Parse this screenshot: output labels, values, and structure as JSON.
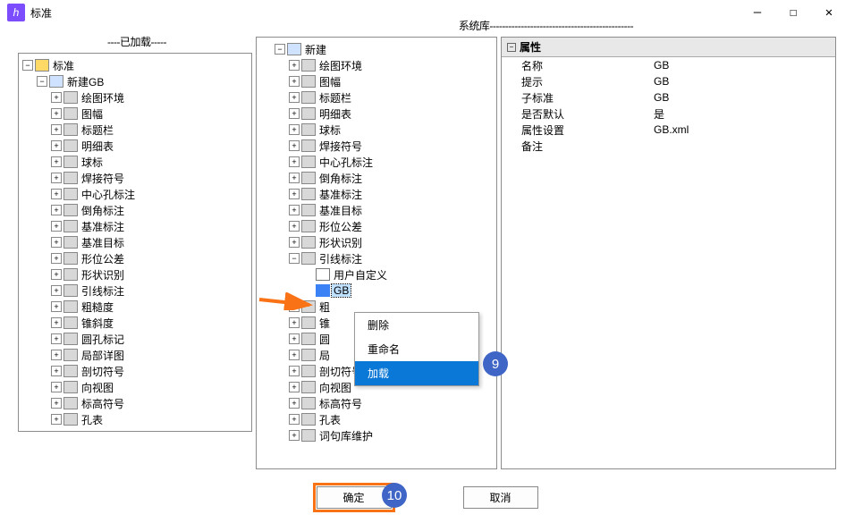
{
  "window": {
    "icon_text": "h",
    "title": "标准",
    "min": "—",
    "max": "☐",
    "close": "✕"
  },
  "panels": {
    "loaded_header": "----已加载-----",
    "syslib_header": "系统库----------------------------------------------"
  },
  "left_tree": {
    "root": "标准",
    "folder": "新建GB",
    "items": [
      "绘图环境",
      "图幅",
      "标题栏",
      "明细表",
      "球标",
      "焊接符号",
      "中心孔标注",
      "倒角标注",
      "基准标注",
      "基准目标",
      "形位公差",
      "形状识别",
      "引线标注",
      "粗糙度",
      "锥斜度",
      "圆孔标记",
      "局部详图",
      "剖切符号",
      "向视图",
      "标高符号",
      "孔表"
    ]
  },
  "mid_tree": {
    "root": "新建",
    "items_top": [
      "绘图环境",
      "图幅",
      "标题栏",
      "明细表",
      "球标",
      "焊接符号",
      "中心孔标注",
      "倒角标注",
      "基准标注",
      "基准目标",
      "形位公差",
      "形状识别"
    ],
    "leader": "引线标注",
    "user_defined": "用户自定义",
    "selected": "GB",
    "items_bottom": [
      "粗",
      "锥",
      "圆",
      "局",
      "剖切符号",
      "向视图",
      "标高符号",
      "孔表",
      "词句库维护"
    ]
  },
  "ctx_menu": {
    "delete": "删除",
    "rename": "重命名",
    "load": "加载"
  },
  "props": {
    "header": "属性",
    "rows": [
      {
        "k": "名称",
        "v": "GB"
      },
      {
        "k": "提示",
        "v": "GB"
      },
      {
        "k": "子标准",
        "v": "GB"
      },
      {
        "k": "是否默认",
        "v": "是"
      },
      {
        "k": "属性设置",
        "v": "GB.xml"
      },
      {
        "k": "备注",
        "v": ""
      }
    ]
  },
  "callouts": {
    "c9": "9",
    "c10": "10"
  },
  "buttons": {
    "ok": "确定",
    "cancel": "取消"
  }
}
